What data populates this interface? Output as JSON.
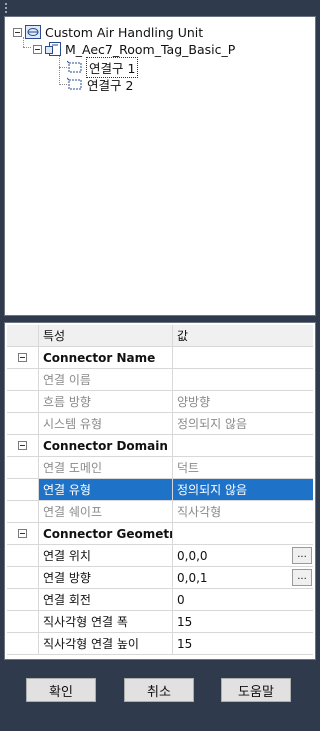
{
  "tree": {
    "root": {
      "label": "Custom Air Handling Unit",
      "icon": "family-icon"
    },
    "child": {
      "label": "M_Aec7_Room_Tag_Basic_P",
      "icon": "tag-family-icon"
    },
    "connectors": [
      {
        "label": "연결구 1",
        "icon": "connector-icon"
      },
      {
        "label": "연결구 2",
        "icon": "connector-icon"
      }
    ]
  },
  "grid": {
    "header": {
      "name": "특성",
      "value": "값"
    },
    "sections": [
      {
        "title": "Connector Name",
        "rows": [
          {
            "name": "연결 이름",
            "value": ""
          },
          {
            "name": "흐름 방향",
            "value": "양방향"
          },
          {
            "name": "시스템 유형",
            "value": "정의되지 않음"
          }
        ]
      },
      {
        "title": "Connector Domain",
        "rows": [
          {
            "name": "연결 도메인",
            "value": "덕트"
          },
          {
            "name": "연결 유형",
            "value": "정의되지 않음"
          },
          {
            "name": "연결 쉐이프",
            "value": "직사각형"
          }
        ]
      },
      {
        "title": "Connector Geometry",
        "rows": [
          {
            "name": "연결 위치",
            "value": "0,0,0",
            "button": "..."
          },
          {
            "name": "연결 방향",
            "value": "0,0,1",
            "button": "..."
          },
          {
            "name": "연결 회전",
            "value": "0"
          },
          {
            "name": "직사각형 연결 폭",
            "value": "15"
          },
          {
            "name": "직사각형 연결 높이",
            "value": "15"
          }
        ]
      }
    ]
  },
  "buttons": {
    "ok": "확인",
    "cancel": "취소",
    "help": "도움말"
  },
  "colors": {
    "background": "#2f3a4d",
    "selection": "#1e73c8"
  }
}
